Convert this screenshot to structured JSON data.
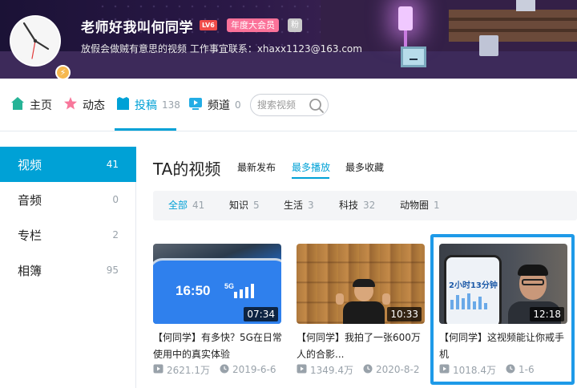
{
  "user": {
    "name": "老师好我叫何同学",
    "level": "LV6",
    "vip": "年度大会员",
    "fans_badge": "粉",
    "sign": "放假会做贼有意思的视频 工作事宜联系：xhaxx1123@163.com"
  },
  "nav": {
    "tabs": [
      {
        "label": "主页",
        "icon": "home-icon"
      },
      {
        "label": "动态",
        "icon": "dynamic-icon"
      },
      {
        "label": "投稿",
        "count": "138",
        "icon": "upload-icon"
      },
      {
        "label": "频道",
        "count": "0",
        "icon": "channel-icon"
      }
    ],
    "search_placeholder": "搜索视频"
  },
  "sidebar": {
    "items": [
      {
        "label": "视频",
        "count": "41"
      },
      {
        "label": "音频",
        "count": "0"
      },
      {
        "label": "专栏",
        "count": "2"
      },
      {
        "label": "相簿",
        "count": "95"
      }
    ]
  },
  "main": {
    "title": "TA的视频",
    "sort": [
      "最新发布",
      "最多播放",
      "最多收藏"
    ],
    "filters": [
      {
        "label": "全部",
        "count": "41"
      },
      {
        "label": "知识",
        "count": "5"
      },
      {
        "label": "生活",
        "count": "3"
      },
      {
        "label": "科技",
        "count": "32"
      },
      {
        "label": "动物圈",
        "count": "1"
      }
    ]
  },
  "videos": [
    {
      "duration": "07:34",
      "title": "【何同学】有多快？5G在日常使用中的真实体验",
      "views": "2621.1万",
      "date": "2019-6-6",
      "thumb_text": "16:50",
      "thumb_net": "5G"
    },
    {
      "duration": "10:33",
      "title": "【何同学】我拍了一张600万人的合影...",
      "views": "1349.4万",
      "date": "2020-8-2"
    },
    {
      "duration": "12:18",
      "title": "【何同学】这视频能让你戒手机",
      "views": "1018.4万",
      "date": "1-6",
      "thumb_text": "2小时13分钟"
    }
  ],
  "colors": {
    "accent": "#00a1d6",
    "pink": "#fb7299",
    "highlight": "#1e9ae8"
  }
}
